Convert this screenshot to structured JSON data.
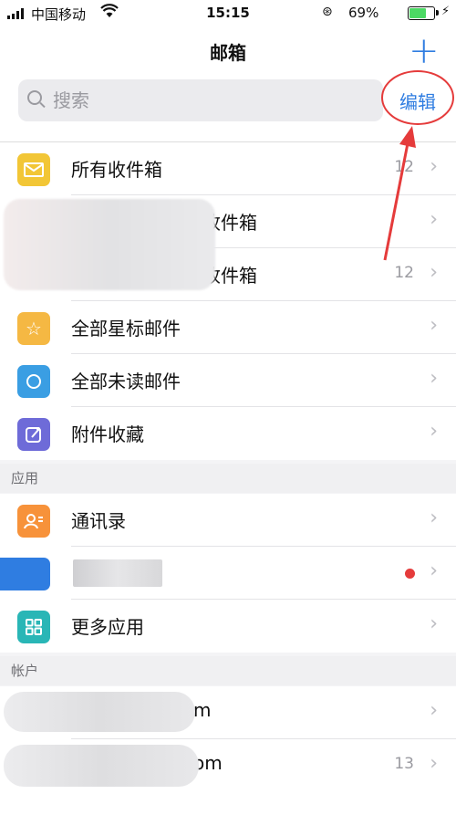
{
  "status_bar": {
    "carrier": "中国移动",
    "time": "15:15",
    "battery": "69%",
    "battery_level": 0.69
  },
  "nav": {
    "title": "邮箱",
    "add_icon": "plus-icon",
    "edit_label": "编辑"
  },
  "search": {
    "placeholder": "搜索"
  },
  "mailboxes": [
    {
      "label": "所有收件箱",
      "count": "12",
      "icon": "envelope-icon",
      "color": "#f2c636"
    },
    {
      "label": "收件箱",
      "count": "",
      "icon": "avatar-blurred"
    },
    {
      "label": "收件箱",
      "count": "12",
      "icon": "avatar-blurred"
    },
    {
      "label": "全部星标邮件",
      "count": "",
      "icon": "star-icon",
      "color": "#f5b843"
    },
    {
      "label": "全部未读邮件",
      "count": "",
      "icon": "circle-icon",
      "color": "#3a9ee3"
    },
    {
      "label": "附件收藏",
      "count": "",
      "icon": "attachment-icon",
      "color": "#6e6bd8"
    }
  ],
  "sections": {
    "apps": "应用",
    "accounts": "帐户"
  },
  "apps": [
    {
      "label": "通讯录",
      "icon": "contacts-icon",
      "color": "#f7923a"
    },
    {
      "label": "",
      "icon": "blue-app-icon",
      "color": "#2f7de1"
    },
    {
      "label": "更多应用",
      "icon": "grid-icon",
      "color": "#29b6b6"
    }
  ],
  "accounts": [
    {
      "label": "m",
      "count": ""
    },
    {
      "label": "om",
      "count": "13"
    }
  ]
}
